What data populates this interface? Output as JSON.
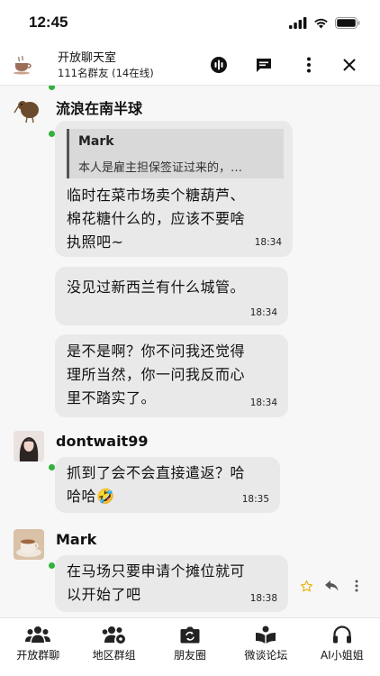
{
  "status_bar": {
    "time": "12:45"
  },
  "header": {
    "title": "开放聊天室",
    "subtitle": "111名群友 (14在线)",
    "avatar_icon": "coffee-cup-icon",
    "actions": [
      "podcast-icon",
      "chat-icon",
      "more-vertical-icon",
      "close-icon"
    ]
  },
  "messages": [
    {
      "sender": "流浪在南半球",
      "bubbles": [
        {
          "quote": {
            "name": "Mark",
            "text": "本人是雇主担保签证过来的，…"
          },
          "lines": [
            "临时在菜市场卖个糖葫芦、",
            "棉花糖什么的，应该不要啥",
            "执照吧~"
          ],
          "time": "18:34"
        },
        {
          "lines": [
            "没见过新西兰有什么城管。"
          ],
          "time": "18:34"
        },
        {
          "lines": [
            "是不是啊？你不问我还觉得",
            "理所当然，你一问我反而心",
            "里不踏实了。"
          ],
          "time": "18:34"
        }
      ]
    },
    {
      "sender": "dontwait99",
      "bubbles": [
        {
          "lines": [
            "抓到了会不会直接遣返？哈",
            "哈哈🤣"
          ],
          "time": "18:35"
        }
      ]
    },
    {
      "sender": "Mark",
      "bubbles": [
        {
          "lines": [
            "在马场只要申请个摊位就可",
            "以开始了吧"
          ],
          "time": "18:38"
        }
      ]
    }
  ],
  "message_actions": [
    "star-icon",
    "reply-icon",
    "more-vertical-icon"
  ],
  "bottom_nav": [
    {
      "label": "开放群聊",
      "icon": "group-icon"
    },
    {
      "label": "地区群组",
      "icon": "group-settings-icon"
    },
    {
      "label": "朋友圈",
      "icon": "camera-switch-icon"
    },
    {
      "label": "微谈论坛",
      "icon": "book-icon"
    },
    {
      "label": "AI小姐姐",
      "icon": "headphones-icon"
    }
  ],
  "colors": {
    "online": "#33b13c",
    "bubble": "#e9e9e9",
    "star": "#e8b81d"
  }
}
